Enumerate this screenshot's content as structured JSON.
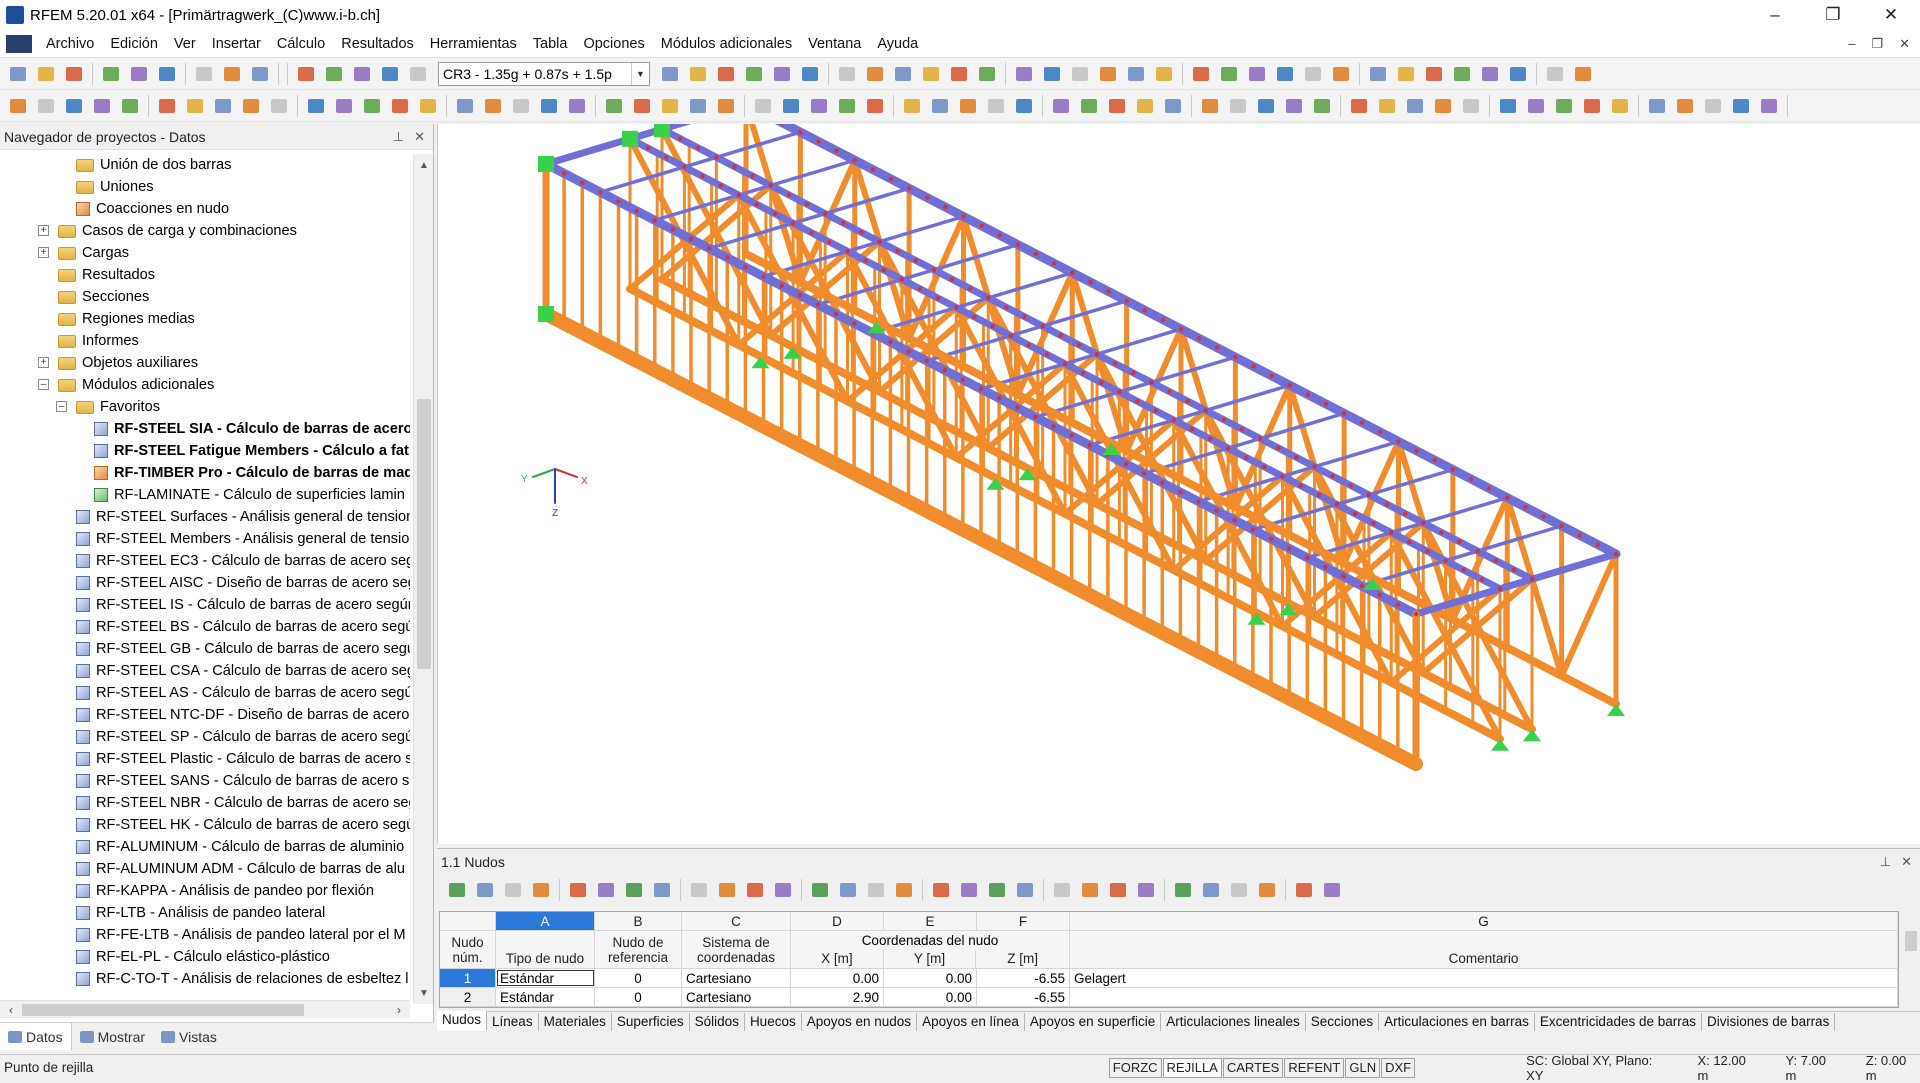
{
  "app": {
    "title": "RFEM 5.20.01 x64 - [Primärtragwerk_(C)www.i-b.ch]",
    "window_controls": [
      "–",
      "❐",
      "✕"
    ],
    "doc_controls": [
      "–",
      "❐",
      "✕"
    ]
  },
  "menu": [
    "Archivo",
    "Edición",
    "Ver",
    "Insertar",
    "Cálculo",
    "Resultados",
    "Herramientas",
    "Tabla",
    "Opciones",
    "Módulos adicionales",
    "Ventana",
    "Ayuda"
  ],
  "toolbar": {
    "load_combo": "CR3 - 1.35g + 0.87s + 1.5p"
  },
  "navigator": {
    "title": "Navegador de proyectos - Datos",
    "items": [
      {
        "label": "Unión de dos barras",
        "icon": "folder-icon",
        "bold": false
      },
      {
        "label": "Uniones",
        "icon": "folder-icon",
        "bold": false
      },
      {
        "label": "Coacciones en nudo",
        "icon": "constraint-icon",
        "bold": false
      },
      {
        "label": "Casos de carga y combinaciones",
        "icon": "folder-icon",
        "bold": false
      },
      {
        "label": "Cargas",
        "icon": "folder-icon",
        "bold": false
      },
      {
        "label": "Resultados",
        "icon": "folder-icon",
        "bold": false
      },
      {
        "label": "Secciones",
        "icon": "folder-icon",
        "bold": false
      },
      {
        "label": "Regiones medias",
        "icon": "folder-icon",
        "bold": false
      },
      {
        "label": "Informes",
        "icon": "folder-icon",
        "bold": false
      },
      {
        "label": "Objetos auxiliares",
        "icon": "folder-icon",
        "bold": false
      },
      {
        "label": "Módulos adicionales",
        "icon": "folder-icon",
        "bold": false
      },
      {
        "label": "Favoritos",
        "icon": "folder-icon",
        "bold": false
      },
      {
        "label": "RF-STEEL SIA - Cálculo de barras de acero",
        "icon": "module-icon",
        "bold": true
      },
      {
        "label": "RF-STEEL Fatigue Members - Cálculo a fat",
        "icon": "module-icon",
        "bold": true
      },
      {
        "label": "RF-TIMBER Pro - Cálculo de barras de mad",
        "icon": "timber-module-icon",
        "bold": true
      },
      {
        "label": "RF-LAMINATE - Cálculo de superficies lamin",
        "icon": "laminate-module-icon",
        "bold": false
      },
      {
        "label": "RF-STEEL Surfaces - Análisis general de tension",
        "icon": "module-icon",
        "bold": false
      },
      {
        "label": "RF-STEEL Members - Análisis general de tensior",
        "icon": "module-icon",
        "bold": false
      },
      {
        "label": "RF-STEEL EC3 - Cálculo de barras de acero segú",
        "icon": "module-icon",
        "bold": false
      },
      {
        "label": "RF-STEEL AISC - Diseño de barras de acero segú",
        "icon": "module-icon",
        "bold": false
      },
      {
        "label": "RF-STEEL IS - Cálculo de barras de acero según",
        "icon": "module-icon",
        "bold": false
      },
      {
        "label": "RF-STEEL BS - Cálculo de barras de acero segúr",
        "icon": "module-icon",
        "bold": false
      },
      {
        "label": "RF-STEEL GB - Cálculo de barras de acero segúi",
        "icon": "module-icon",
        "bold": false
      },
      {
        "label": "RF-STEEL CSA - Cálculo de barras de acero segú",
        "icon": "module-icon",
        "bold": false
      },
      {
        "label": "RF-STEEL AS - Cálculo de barras de acero segúr",
        "icon": "module-icon",
        "bold": false
      },
      {
        "label": "RF-STEEL NTC-DF - Diseño de barras de acero s",
        "icon": "module-icon",
        "bold": false
      },
      {
        "label": "RF-STEEL SP - Cálculo de barras de acero segúr",
        "icon": "module-icon",
        "bold": false
      },
      {
        "label": "RF-STEEL Plastic - Cálculo de barras de acero se",
        "icon": "module-icon",
        "bold": false
      },
      {
        "label": "RF-STEEL SANS - Cálculo de barras de acero se",
        "icon": "module-icon",
        "bold": false
      },
      {
        "label": "RF-STEEL NBR - Cálculo de barras de acero seg",
        "icon": "module-icon",
        "bold": false
      },
      {
        "label": "RF-STEEL HK - Cálculo de barras de acero segú",
        "icon": "module-icon",
        "bold": false
      },
      {
        "label": "RF-ALUMINUM - Cálculo de barras de aluminio",
        "icon": "module-icon",
        "bold": false
      },
      {
        "label": "RF-ALUMINUM ADM - Cálculo de barras de alu",
        "icon": "module-icon",
        "bold": false
      },
      {
        "label": "RF-KAPPA - Análisis de pandeo por flexión",
        "icon": "module-icon",
        "bold": false
      },
      {
        "label": "RF-LTB - Análisis de pandeo lateral",
        "icon": "module-icon",
        "bold": false
      },
      {
        "label": "RF-FE-LTB - Análisis de pandeo lateral por el M",
        "icon": "module-icon",
        "bold": false
      },
      {
        "label": "RF-EL-PL - Cálculo elástico-plástico",
        "icon": "module-icon",
        "bold": false
      },
      {
        "label": "RF-C-TO-T - Análisis de relaciones de esbeltez l",
        "icon": "module-icon",
        "bold": false
      }
    ],
    "tabs": [
      "Datos",
      "Mostrar",
      "Vistas"
    ]
  },
  "viewport": {
    "axes": {
      "x": "X",
      "y": "Y",
      "z": "Z"
    }
  },
  "table": {
    "title": "1.1 Nudos",
    "col_letters": [
      "A",
      "B",
      "C",
      "D",
      "E",
      "F",
      "G"
    ],
    "headers": {
      "rownum_top": "Nudo",
      "rownum_bottom": "núm.",
      "a": "Tipo de nudo",
      "b_top": "Nudo de",
      "b_bottom": "referencia",
      "c_top": "Sistema de",
      "c_bottom": "coordenadas",
      "coords_group": "Coordenadas del nudo",
      "d": "X [m]",
      "e": "Y [m]",
      "f": "Z [m]",
      "g": "Comentario"
    },
    "rows": [
      {
        "num": "1",
        "tipo": "Estándar",
        "ref": "0",
        "sistema": "Cartesiano",
        "x": "0.00",
        "y": "0.00",
        "z": "-6.55",
        "comentario": "Gelagert"
      },
      {
        "num": "2",
        "tipo": "Estándar",
        "ref": "0",
        "sistema": "Cartesiano",
        "x": "2.90",
        "y": "0.00",
        "z": "-6.55",
        "comentario": ""
      }
    ],
    "tabs": [
      "Nudos",
      "Líneas",
      "Materiales",
      "Superficies",
      "Sólidos",
      "Huecos",
      "Apoyos en nudos",
      "Apoyos en línea",
      "Apoyos en superficie",
      "Articulaciones lineales",
      "Secciones",
      "Articulaciones en barras",
      "Excentricidades de barras",
      "Divisiones de barras"
    ]
  },
  "status": {
    "text": "Punto de rejilla",
    "buttons": [
      "FORZC",
      "REJILLA",
      "CARTES",
      "REFENT",
      "GLN",
      "DXF"
    ],
    "sc": "SC: Global XY, Plano: XY",
    "x": "X: 12.00 m",
    "y": "Y: 7.00 m",
    "z": "Z: 0.00 m"
  },
  "colors": {
    "orange_member": "#f08c2c",
    "blue_member": "#6f6fd6",
    "support_green": "#3ad14a",
    "selection_blue": "#2b78d8"
  }
}
